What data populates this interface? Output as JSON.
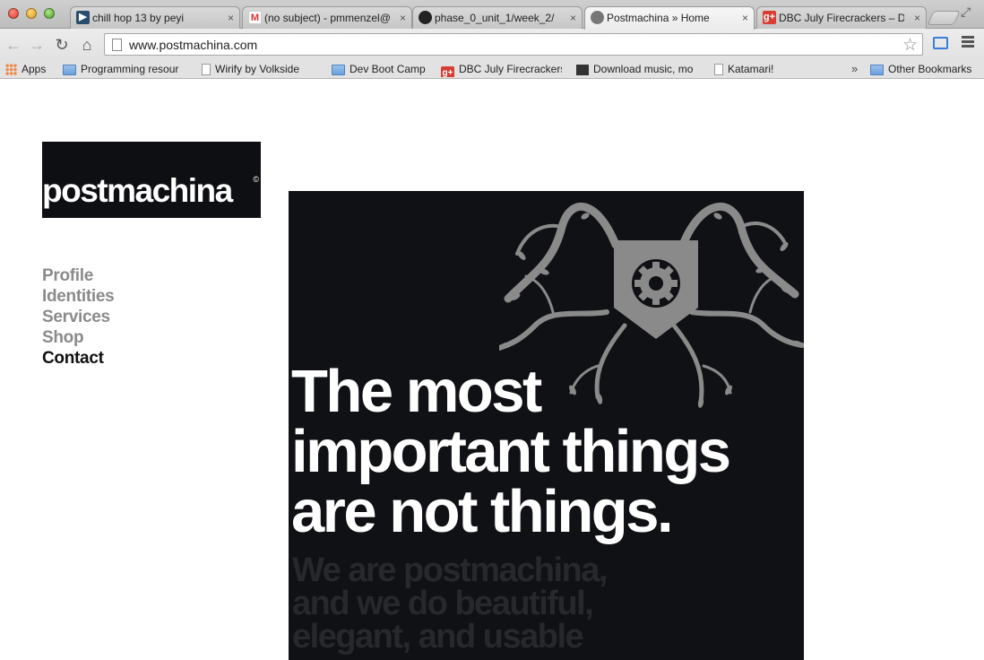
{
  "browser": {
    "tabs": [
      {
        "title": "chill hop 13 by peyi",
        "icon": "soundcloud-icon",
        "audio": true
      },
      {
        "title": "(no subject) - pmmenzel@",
        "icon": "gmail-icon"
      },
      {
        "title": "phase_0_unit_1/week_2/",
        "icon": "github-icon"
      },
      {
        "title": "Postmachina » Home",
        "icon": "postmachina-icon",
        "active": true
      },
      {
        "title": "DBC July Firecrackers – Di",
        "icon": "googleplus-icon"
      }
    ],
    "url": "www.postmachina.com",
    "bookmarks": [
      {
        "label": "Apps",
        "icon": "apps-grid-icon"
      },
      {
        "label": "Programming resour",
        "icon": "folder-icon"
      },
      {
        "label": "Wirify by Volkside",
        "icon": "page-icon"
      },
      {
        "label": "Dev Boot Camp",
        "icon": "folder-icon"
      },
      {
        "label": "DBC July Firecrackers",
        "icon": "googleplus-icon"
      },
      {
        "label": "Download music, mo",
        "icon": "invader-icon"
      },
      {
        "label": "Katamari!",
        "icon": "page-icon"
      }
    ],
    "bookmarks_overflow": "»",
    "other_bookmarks": "Other Bookmarks",
    "close_glyph": "×"
  },
  "site": {
    "logo": "postmachina",
    "logo_mark": "©",
    "nav": [
      {
        "label": "Profile"
      },
      {
        "label": "Identities"
      },
      {
        "label": "Services"
      },
      {
        "label": "Shop"
      },
      {
        "label": "Contact",
        "current": true
      }
    ],
    "hero": {
      "headline": [
        "The most",
        "important things",
        "are not things."
      ],
      "subline": [
        "We are postmachina,",
        "and we do beautiful,",
        "elegant, and usable"
      ]
    }
  },
  "colors": {
    "hero_bg": "#0f1114",
    "mascot": "#8a8a8a",
    "nav_inactive": "#8b8b8b",
    "nav_active": "#111111"
  }
}
